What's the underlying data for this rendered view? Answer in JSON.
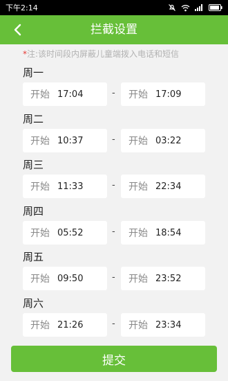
{
  "status_bar": {
    "time": "下午2:14"
  },
  "header": {
    "title": "拦截设置"
  },
  "note": {
    "star": "*",
    "text": "注:该时间段内屏蔽儿童端拨入电话和短信"
  },
  "days": [
    {
      "label": "周一",
      "start_keyword": "开始",
      "start": "17:04",
      "separator": "-",
      "end_keyword": "开始",
      "end": "17:09"
    },
    {
      "label": "周二",
      "start_keyword": "开始",
      "start": "10:37",
      "separator": "-",
      "end_keyword": "开始",
      "end": "03:22"
    },
    {
      "label": "周三",
      "start_keyword": "开始",
      "start": "11:33",
      "separator": "-",
      "end_keyword": "开始",
      "end": "22:34"
    },
    {
      "label": "周四",
      "start_keyword": "开始",
      "start": "05:52",
      "separator": "-",
      "end_keyword": "开始",
      "end": "18:54"
    },
    {
      "label": "周五",
      "start_keyword": "开始",
      "start": "09:50",
      "separator": "-",
      "end_keyword": "开始",
      "end": "23:52"
    },
    {
      "label": "周六",
      "start_keyword": "开始",
      "start": "21:26",
      "separator": "-",
      "end_keyword": "开始",
      "end": "23:34"
    }
  ],
  "footer": {
    "submit_label": "提交"
  },
  "colors": {
    "accent": "#67bf39",
    "background": "#f2f2f2",
    "required_star": "#e53935",
    "note_text": "#b2b2b2"
  },
  "icons": [
    "back-arrow-icon",
    "mute-icon",
    "wifi-icon",
    "signal-icon",
    "battery-icon"
  ]
}
